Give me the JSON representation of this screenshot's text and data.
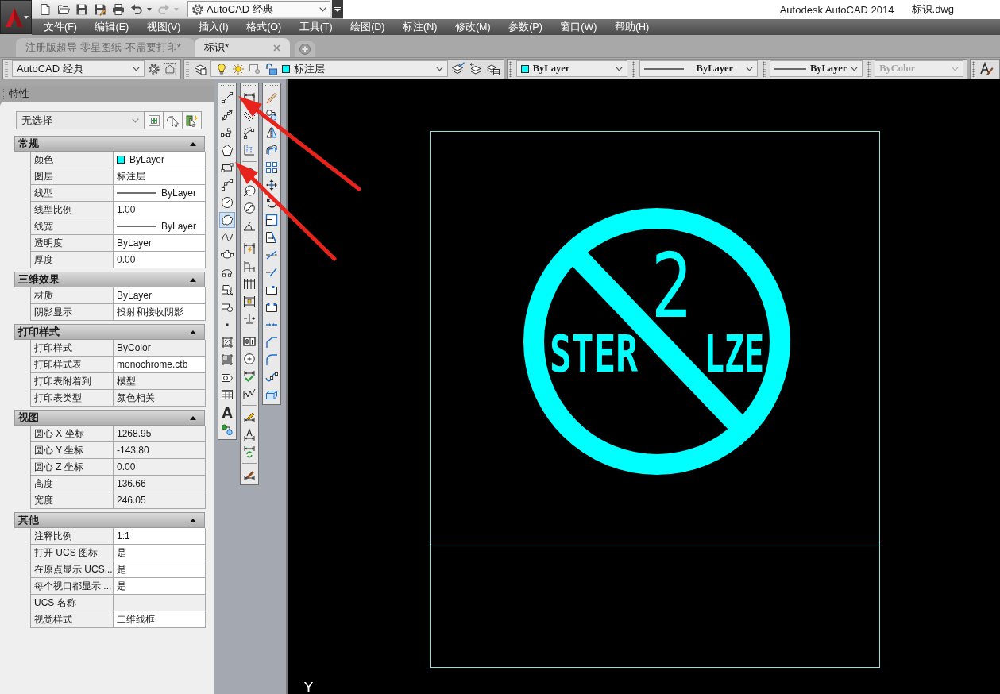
{
  "quick_access": [
    {
      "kind": "new",
      "disabled": false
    },
    {
      "kind": "open",
      "disabled": false
    },
    {
      "kind": "save",
      "disabled": false
    },
    {
      "kind": "saveas",
      "disabled": false
    },
    {
      "kind": "print",
      "disabled": false
    },
    {
      "kind": "undo",
      "disabled": false
    },
    {
      "kind": "redo",
      "disabled": true
    }
  ],
  "workspace_switcher": "AutoCAD 经典",
  "title": {
    "app": "Autodesk AutoCAD 2014",
    "file": "标识.dwg"
  },
  "menu": [
    "文件(F)",
    "编辑(E)",
    "视图(V)",
    "插入(I)",
    "格式(O)",
    "工具(T)",
    "绘图(D)",
    "标注(N)",
    "修改(M)",
    "参数(P)",
    "窗口(W)",
    "帮助(H)"
  ],
  "doc_tabs": [
    {
      "label": "注册版超导-零星图纸-不需要打印*",
      "selected": false
    },
    {
      "label": "标识*",
      "selected": true
    }
  ],
  "workspace_toolbar": {
    "workspace": "AutoCAD 经典"
  },
  "layer_toolbar": {
    "layer": "标注层",
    "on": true,
    "frozen": false,
    "locked": false,
    "color": "#00ffff"
  },
  "properties_toolbar": {
    "color": {
      "value": "ByLayer",
      "color": "#00ffff"
    },
    "linetype": "ByLayer",
    "lineweight": "ByLayer",
    "plot_style": {
      "value": "ByColor",
      "disabled": true
    }
  },
  "properties_panel": {
    "title": "特性",
    "selection": "无选择",
    "sections": [
      {
        "title": "常规",
        "expanded": true,
        "rows": [
          {
            "label": "颜色",
            "value": "ByLayer",
            "kind": "color",
            "color": "#00ffff",
            "readonly": false
          },
          {
            "label": "图层",
            "value": "标注层",
            "kind": "text",
            "readonly": false
          },
          {
            "label": "线型",
            "value": "ByLayer",
            "kind": "line",
            "readonly": false
          },
          {
            "label": "线型比例",
            "value": "1.00",
            "kind": "text",
            "readonly": false
          },
          {
            "label": "线宽",
            "value": "ByLayer",
            "kind": "line",
            "readonly": false
          },
          {
            "label": "透明度",
            "value": "ByLayer",
            "kind": "text",
            "readonly": false
          },
          {
            "label": "厚度",
            "value": "0.00",
            "kind": "text",
            "readonly": false
          }
        ]
      },
      {
        "title": "三维效果",
        "expanded": true,
        "rows": [
          {
            "label": "材质",
            "value": "ByLayer",
            "kind": "text",
            "readonly": false
          },
          {
            "label": "阴影显示",
            "value": "投射和接收阴影",
            "kind": "text",
            "readonly": false
          }
        ]
      },
      {
        "title": "打印样式",
        "expanded": true,
        "rows": [
          {
            "label": "打印样式",
            "value": "ByColor",
            "kind": "text",
            "readonly": true
          },
          {
            "label": "打印样式表",
            "value": "monochrome.ctb",
            "kind": "text",
            "readonly": false
          },
          {
            "label": "打印表附着到",
            "value": "模型",
            "kind": "text",
            "readonly": true
          },
          {
            "label": "打印表类型",
            "value": "颜色相关",
            "kind": "text",
            "readonly": true
          }
        ]
      },
      {
        "title": "视图",
        "expanded": true,
        "rows": [
          {
            "label": "圆心 X 坐标",
            "value": "1268.95",
            "kind": "text",
            "readonly": true
          },
          {
            "label": "圆心 Y 坐标",
            "value": "-143.80",
            "kind": "text",
            "readonly": true
          },
          {
            "label": "圆心 Z 坐标",
            "value": "0.00",
            "kind": "text",
            "readonly": true
          },
          {
            "label": "高度",
            "value": "136.66",
            "kind": "text",
            "readonly": true
          },
          {
            "label": "宽度",
            "value": "246.05",
            "kind": "text",
            "readonly": true
          }
        ]
      },
      {
        "title": "其他",
        "expanded": true,
        "rows": [
          {
            "label": "注释比例",
            "value": "1:1",
            "kind": "text",
            "readonly": false
          },
          {
            "label": "打开 UCS 图标",
            "value": "是",
            "kind": "text",
            "readonly": false
          },
          {
            "label": "在原点显示 UCS...",
            "value": "是",
            "kind": "text",
            "readonly": false
          },
          {
            "label": "每个视口都显示 ...",
            "value": "是",
            "kind": "text",
            "readonly": false
          },
          {
            "label": "UCS 名称",
            "kind": "text",
            "readonly": true
          },
          {
            "label": "视觉样式",
            "value": "二维线框",
            "kind": "text",
            "readonly": false
          }
        ]
      }
    ]
  },
  "toolbars": [
    {
      "buttons": [
        {
          "kind": "line",
          "selected": false
        },
        {
          "kind": "xline",
          "selected": false
        },
        {
          "kind": "pline",
          "selected": false
        },
        {
          "kind": "polygon",
          "selected": false
        },
        {
          "kind": "rectangle",
          "selected": false
        },
        {
          "kind": "arc",
          "selected": false
        },
        {
          "kind": "circle",
          "selected": false
        },
        {
          "kind": "cloud",
          "selected": true
        },
        {
          "kind": "spline",
          "selected": false
        },
        {
          "kind": "ellipse",
          "selected": false
        },
        {
          "kind": "ellipsearc",
          "selected": false
        },
        {
          "kind": "insert",
          "selected": false
        },
        {
          "kind": "block",
          "selected": false
        },
        {
          "kind": "point",
          "selected": false
        },
        {
          "kind": "hatch",
          "selected": false
        },
        {
          "kind": "gradient",
          "selected": false
        },
        {
          "kind": "region",
          "selected": false
        },
        {
          "kind": "table",
          "selected": false
        },
        {
          "kind": "mtext",
          "glyph": "A",
          "selected": false
        },
        {
          "kind": "addselected",
          "selected": false
        }
      ]
    },
    {
      "buttons": [
        {
          "kind": "linear"
        },
        {
          "kind": "aligned"
        },
        {
          "kind": "arclength"
        },
        {
          "kind": "ordinate"
        },
        {
          "kind": "separator"
        },
        {
          "kind": "radius"
        },
        {
          "kind": "jogged"
        },
        {
          "kind": "diameter"
        },
        {
          "kind": "angular"
        },
        {
          "kind": "separator"
        },
        {
          "kind": "quick"
        },
        {
          "kind": "baseline"
        },
        {
          "kind": "continue"
        },
        {
          "kind": "space"
        },
        {
          "kind": "dimbreak"
        },
        {
          "kind": "separator"
        },
        {
          "kind": "tolerance"
        },
        {
          "kind": "center"
        },
        {
          "kind": "inspect"
        },
        {
          "kind": "joglinear"
        },
        {
          "kind": "separator"
        },
        {
          "kind": "dimedit"
        },
        {
          "kind": "textedit"
        },
        {
          "kind": "update"
        },
        {
          "kind": "separator"
        },
        {
          "kind": "dimstyle"
        }
      ]
    },
    {
      "buttons": [
        {
          "kind": "erase"
        },
        {
          "kind": "copy"
        },
        {
          "kind": "mirror"
        },
        {
          "kind": "offset"
        },
        {
          "kind": "array"
        },
        {
          "kind": "move"
        },
        {
          "kind": "rotate"
        },
        {
          "kind": "scale"
        },
        {
          "kind": "stretch"
        },
        {
          "kind": "trim"
        },
        {
          "kind": "extend"
        },
        {
          "kind": "breakpoint"
        },
        {
          "kind": "break"
        },
        {
          "kind": "join"
        },
        {
          "kind": "chamfer"
        },
        {
          "kind": "fillet"
        },
        {
          "kind": "blend"
        },
        {
          "kind": "explode"
        }
      ]
    }
  ],
  "canvas": {
    "digit": "2",
    "label_left": "STER",
    "label_right": "LZE",
    "ucs_axis": "Y"
  }
}
